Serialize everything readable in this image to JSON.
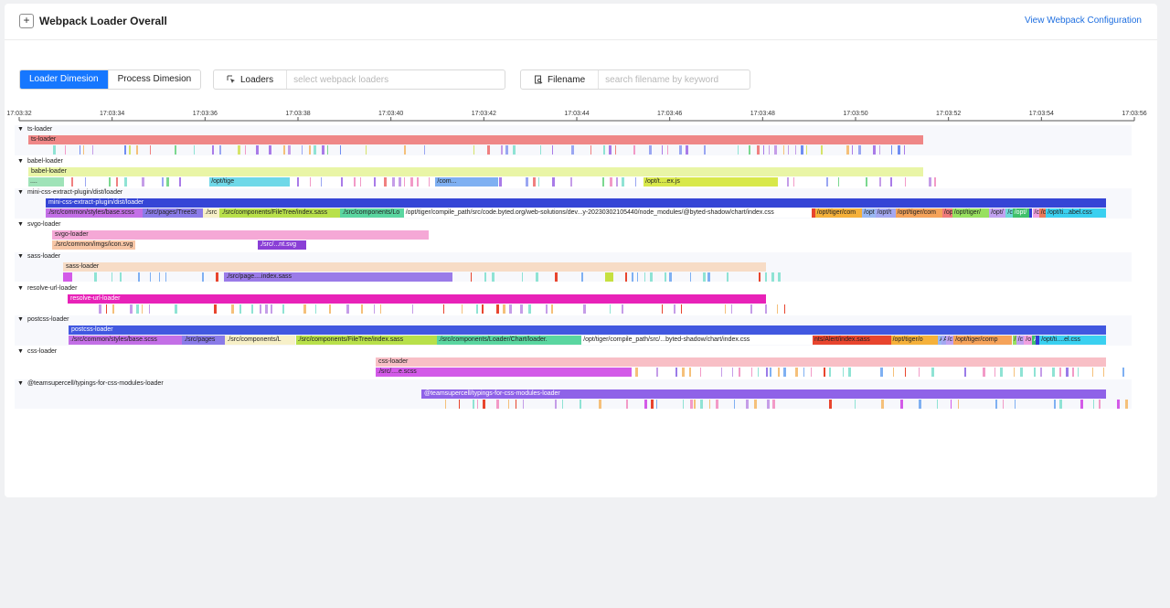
{
  "header": {
    "title": "Webpack Loader Overall",
    "expand_symbol": "+",
    "config_link": "View Webpack Configuration"
  },
  "controls": {
    "dimension_tabs": [
      {
        "label": "Loader Dimesion",
        "active": true
      },
      {
        "label": "Process Dimesion",
        "active": false
      }
    ],
    "loaders_filter": {
      "label": "Loaders",
      "placeholder": "select webpack loaders"
    },
    "filename_filter": {
      "label": "Filename",
      "placeholder": "search filename by keyword"
    }
  },
  "timeline": {
    "ticks": [
      "17:03:32",
      "17:03:34",
      "17:03:36",
      "17:03:38",
      "17:03:40",
      "17:03:42",
      "17:03:44",
      "17:03:46",
      "17:03:48",
      "17:03:50",
      "17:03:52",
      "17:03:54",
      "17:03:56"
    ],
    "rows": [
      {
        "name": "ts-loader",
        "bar_label": "ts-loader",
        "color": "#ef8787",
        "files": [],
        "tick_colors": [
          "#7bd88f",
          "#c59de8",
          "#f5c07a",
          "#9aa6f2",
          "#f29ac7",
          "#8fe3d4",
          "#d6e36a",
          "#6f8df2",
          "#f08080",
          "#a97be8"
        ]
      },
      {
        "name": "babel-loader",
        "bar_label": "babel-loader",
        "color": "#e9f5a6",
        "files": [
          {
            "label": "....",
            "color": "#9fe3b8"
          },
          {
            "label": "/opt/tige",
            "color": "#6fd8e8"
          },
          {
            "label": "/com...",
            "color": "#7fb0f2"
          },
          {
            "label": "/opt/t....ex.js",
            "color": "#d8e84a"
          }
        ],
        "tick_colors": [
          "#7bd88f",
          "#c59de8",
          "#f5c07a",
          "#9aa6f2",
          "#f29ac7",
          "#8fe3d4",
          "#f08080",
          "#a97be8"
        ]
      },
      {
        "name": "mini-css-extract-plugin/dist/loader",
        "bar_label": "mini-css-extract-plugin/dist/loader",
        "color": "#3545d6",
        "files": [
          {
            "label": "./src/common/styles/base.scss",
            "color": "#c36fe6"
          },
          {
            "label": "./src/pages/TreeSt",
            "color": "#8a7be8"
          },
          {
            "label": "./src",
            "color": "#f7f0c8"
          },
          {
            "label": "./src/components/FileTree/index.sass",
            "color": "#b8e04a"
          },
          {
            "label": "./src/components/Lo",
            "color": "#5ad6a0"
          },
          {
            "label": "/opt/tiger/compile_path/src/code.byted.org/web-solutions/dev...y-20230302105440/node_modules/@byted-shadow/chart/index.css",
            "color": "#ffffff"
          },
          {
            "label": "",
            "color": "#e8452e"
          },
          {
            "label": "/opt/tiger/com",
            "color": "#f5b13a"
          },
          {
            "label": "/opt",
            "color": "#9ab8f2"
          },
          {
            "label": "/opt/t",
            "color": "#a4a8f2"
          },
          {
            "label": "/opt/tiger/com",
            "color": "#f5a35a"
          },
          {
            "label": "/op",
            "color": "#ef7a7a"
          },
          {
            "label": "/opt/tiger/",
            "color": "#98e060"
          },
          {
            "label": "/opt/",
            "color": "#c2a2f0"
          },
          {
            "label": "/c",
            "color": "#6fd8d8"
          },
          {
            "label": "/opt/",
            "color": "#3fc06a"
          },
          {
            "label": "",
            "color": "#2f3bd6"
          },
          {
            "label": "/c",
            "color": "#f0a0e0"
          },
          {
            "label": "/c",
            "color": "#e87a5a"
          },
          {
            "label": "/opt/ti...abel.css",
            "color": "#3ad0f0"
          }
        ],
        "tick_colors": []
      },
      {
        "name": "svgo-loader",
        "bar_label": "svgo-loader",
        "color": "#f5a8d6",
        "files": [
          {
            "label": "./src/common/imgs/icon.svg",
            "color": "#f7c6a6"
          },
          {
            "label": "./src/...nt.svg",
            "color": "#8a3fd6"
          }
        ],
        "tick_colors": []
      },
      {
        "name": "sass-loader",
        "bar_label": "sass-loader",
        "color": "#f7dcc6",
        "files": [
          {
            "label": "",
            "color": "#d35ae8"
          },
          {
            "label": "./src/page....index.sass",
            "color": "#9a7be8"
          },
          {
            "label": "",
            "color": "#c6e040"
          }
        ],
        "tick_colors": [
          "#8fe3d4",
          "#7fb0f2",
          "#e8452e"
        ]
      },
      {
        "name": "resolve-url-loader",
        "bar_label": "resolve-url-loader",
        "color": "#e822b8",
        "files": [],
        "tick_colors": [
          "#c59de8",
          "#f5c07a",
          "#8fe3d4",
          "#e8452e"
        ]
      },
      {
        "name": "postcss-loader",
        "bar_label": "postcss-loader",
        "color": "#4158e0",
        "files": [
          {
            "label": "./src/common/styles/base.scss",
            "color": "#c36fe6"
          },
          {
            "label": "./src/pages",
            "color": "#8a7be8"
          },
          {
            "label": "./src/components/L",
            "color": "#f7f0c8"
          },
          {
            "label": "./src/components/FileTree/index.sass",
            "color": "#b8e04a"
          },
          {
            "label": "./src/components/Loader/Chart/loader.",
            "color": "#5ad6a0"
          },
          {
            "label": "/opt/tiger/compile_path/src/...byted-shadow/chart/index.css",
            "color": "#ffffff"
          },
          {
            "label": "nts/Alert/index.sass",
            "color": "#e8452e"
          },
          {
            "label": "/opt/tiger/o",
            "color": "#f5b13a"
          },
          {
            "label": "A",
            "color": "#9ab8f2"
          },
          {
            "label": "A",
            "color": "#a4a8f2"
          },
          {
            "label": "/c",
            "color": "#c2a2f0"
          },
          {
            "label": "/opt/tiger/comp",
            "color": "#f5a35a"
          },
          {
            "label": "/",
            "color": "#98e060"
          },
          {
            "label": "/c",
            "color": "#c2a2f0"
          },
          {
            "label": "/o",
            "color": "#f0a0e0"
          },
          {
            "label": "A",
            "color": "#3fc06a"
          },
          {
            "label": "",
            "color": "#2f3bd6"
          },
          {
            "label": "/opt/ti....el.css",
            "color": "#3ad0f0"
          }
        ],
        "tick_colors": []
      },
      {
        "name": "css-loader",
        "bar_label": "css-loader",
        "color": "#f8bfc6",
        "files": [
          {
            "label": "./src/....e.scss",
            "color": "#d35ae8"
          }
        ],
        "tick_colors": [
          "#9a7be8",
          "#c59de8",
          "#f5c07a",
          "#8fe3d4",
          "#7fb0f2",
          "#e8452e",
          "#f29ac7"
        ]
      },
      {
        "name": "@teamsupercell/typings-for-css-modules-loader",
        "bar_label": "@teamsupercell/typings-for-css-modules-loader",
        "color": "#8f62e8",
        "files": [],
        "tick_colors": [
          "#d35ae8",
          "#c59de8",
          "#f5c07a",
          "#8fe3d4",
          "#7fb0f2",
          "#e8452e",
          "#f29ac7"
        ]
      }
    ]
  }
}
